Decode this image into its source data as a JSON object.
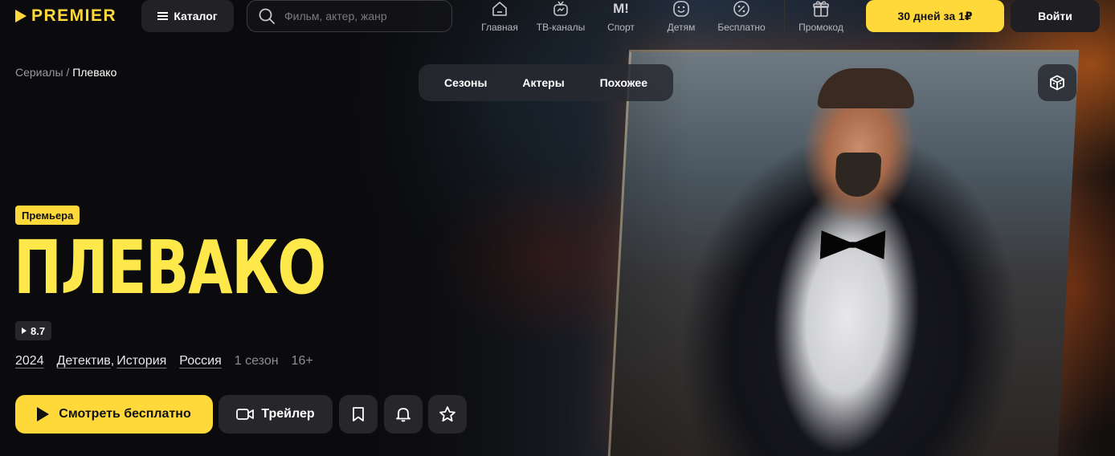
{
  "header": {
    "logo": "PREMIER",
    "catalog_label": "Каталог",
    "search_placeholder": "Фильм, актер, жанр",
    "nav": [
      {
        "label": "Главная",
        "icon": "home-icon"
      },
      {
        "label": "ТВ-каналы",
        "icon": "tv-icon"
      },
      {
        "label": "Спорт",
        "icon": "sport-icon"
      },
      {
        "label": "Детям",
        "icon": "kids-icon"
      },
      {
        "label": "Бесплатно",
        "icon": "discount-icon"
      },
      {
        "label": "Промокод",
        "icon": "gift-icon"
      }
    ],
    "sport_glyph": "M!",
    "promo_label": "30 дней за 1₽",
    "login_label": "Войти"
  },
  "breadcrumb": {
    "parent": "Сериалы",
    "separator": "/",
    "current": "Плевако"
  },
  "tabs": [
    "Сезоны",
    "Актеры",
    "Похожее"
  ],
  "hero": {
    "badge": "Премьера",
    "title": "ПЛЕВАКО",
    "rating": "8.7",
    "year": "2024",
    "genres": [
      "Детектив",
      "История"
    ],
    "genre_separator": ",",
    "country": "Россия",
    "seasons": "1 сезон",
    "age": "16+"
  },
  "actions": {
    "watch_label": "Смотреть бесплатно",
    "trailer_label": "Трейлер",
    "icons": [
      "bookmark-icon",
      "bell-icon",
      "star-icon"
    ]
  },
  "colors": {
    "accent": "#ffd83a",
    "title": "#ffe84a",
    "background": "#0b0b0d",
    "button_dark": "#26262b"
  }
}
